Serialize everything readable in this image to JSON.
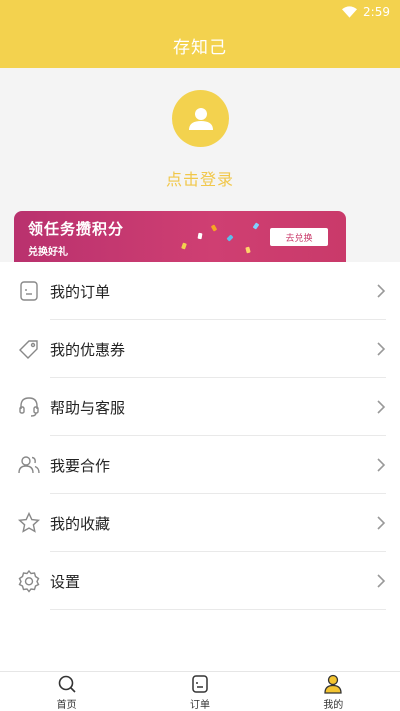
{
  "status_bar": {
    "time": "2:59",
    "wifi_icon": "wifi-icon"
  },
  "header": {
    "title": "存知己"
  },
  "profile": {
    "avatar_icon": "user-icon",
    "login_label": "点击登录"
  },
  "banner": {
    "title": "领任务攒积分",
    "subtitle": "兑换好礼",
    "button_label": "去兑换"
  },
  "menu": {
    "items": [
      {
        "label": "我的订单",
        "icon": "order-icon"
      },
      {
        "label": "我的优惠券",
        "icon": "coupon-tag-icon"
      },
      {
        "label": "帮助与客服",
        "icon": "headset-icon"
      },
      {
        "label": "我要合作",
        "icon": "users-icon"
      },
      {
        "label": "我的收藏",
        "icon": "star-icon"
      },
      {
        "label": "设置",
        "icon": "gear-icon"
      }
    ]
  },
  "tabbar": {
    "items": [
      {
        "label": "首页",
        "icon": "search-icon",
        "active": false
      },
      {
        "label": "订单",
        "icon": "order-icon",
        "active": false
      },
      {
        "label": "我的",
        "icon": "user-icon",
        "active": true
      }
    ]
  },
  "colors": {
    "accent": "#f3d24e",
    "login_text": "#f1c74a",
    "banner": "#c93a6a",
    "active_tab": "#f3c431"
  }
}
